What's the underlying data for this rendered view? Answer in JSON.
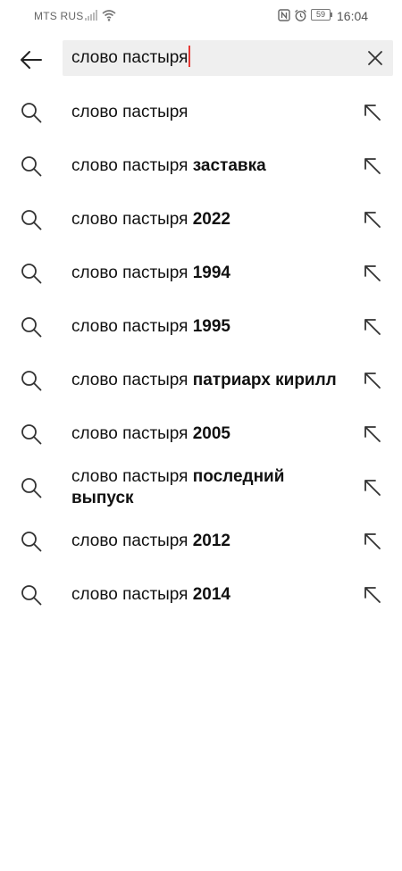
{
  "status_bar": {
    "carrier": "MTS RUS",
    "battery": "59",
    "time": "16:04"
  },
  "search": {
    "query": "слово пастыря"
  },
  "suggestions": [
    {
      "base": "слово пастыря",
      "extra": ""
    },
    {
      "base": "слово пастыря ",
      "extra": "заставка"
    },
    {
      "base": "слово пастыря ",
      "extra": "2022"
    },
    {
      "base": "слово пастыря ",
      "extra": "1994"
    },
    {
      "base": "слово пастыря ",
      "extra": "1995"
    },
    {
      "base": "слово пастыря ",
      "extra": "патриарх кирилл"
    },
    {
      "base": "слово пастыря ",
      "extra": "2005"
    },
    {
      "base": "слово пастыря ",
      "extra": "последний выпуск"
    },
    {
      "base": "слово пастыря ",
      "extra": "2012"
    },
    {
      "base": "слово пастыря ",
      "extra": "2014"
    }
  ],
  "icons": {
    "back": "arrow-left-icon",
    "clear": "close-icon",
    "suggestion": "search-icon",
    "fill": "arrow-up-left-icon"
  },
  "colors": {
    "caret": "#e53935",
    "search_box_bg": "#efefef"
  }
}
